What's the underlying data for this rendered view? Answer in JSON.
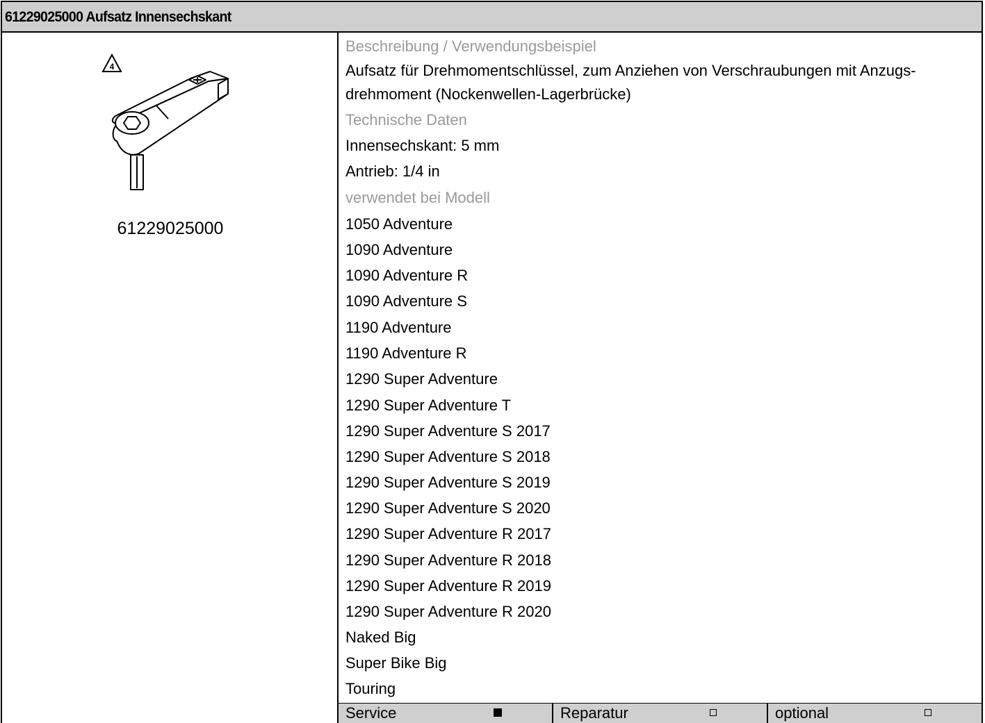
{
  "title": "61229025000 Aufsatz Innensechskant",
  "image": {
    "warning_number": "4",
    "part_number": "61229025000"
  },
  "details": {
    "description_heading": "Beschreibung / Verwendungsbeispiel",
    "description_text": "Aufsatz für Drehmomentschlüssel, zum Anziehen von Verschraubungen mit Anzugs-drehmoment (Nockenwellen-Lagerbrücke)",
    "description_line1": "Aufsatz für Drehmomentschlüssel, zum Anziehen von Verschraubungen mit Anzugs-",
    "description_line2": "drehmoment (Nockenwellen-Lagerbrücke)",
    "technical_heading": "Technische Daten",
    "tech_specs": [
      "Innensechskant: 5 mm",
      "Antrieb: 1/4 in"
    ],
    "models_heading": "verwendet bei Modell",
    "models": [
      "1050 Adventure",
      "1090 Adventure",
      "1090 Adventure R",
      "1090 Adventure S",
      "1190 Adventure",
      "1190 Adventure R",
      "1290 Super Adventure",
      "1290 Super Adventure T",
      "1290 Super Adventure S 2017",
      "1290 Super Adventure S 2018",
      "1290 Super Adventure S 2019",
      "1290 Super Adventure S 2020",
      "1290 Super Adventure R 2017",
      "1290 Super Adventure R 2018",
      "1290 Super Adventure R 2019",
      "1290 Super Adventure R 2020",
      "Naked Big",
      "Super Bike Big",
      "Touring"
    ]
  },
  "footer": {
    "service_label": "Service",
    "service_checked": true,
    "repair_label": "Reparatur",
    "repair_checked": false,
    "optional_label": "optional",
    "optional_checked": false
  }
}
